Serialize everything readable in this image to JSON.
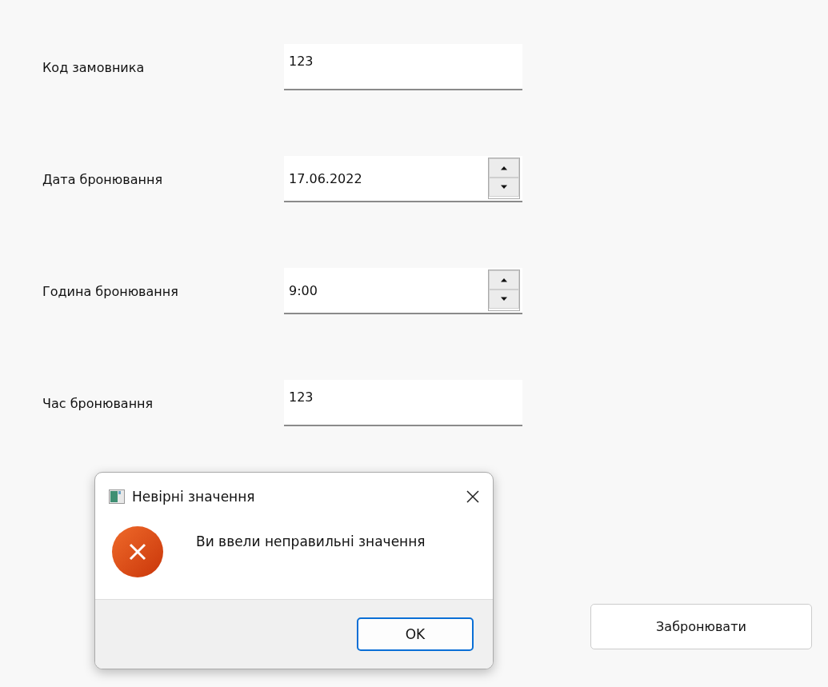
{
  "form": {
    "rows": [
      {
        "label": "Код замовника",
        "kind": "text",
        "value": "123"
      },
      {
        "label": "Дата бронювання",
        "kind": "spin",
        "value": "17.06.2022"
      },
      {
        "label": "Година бронювання",
        "kind": "spin",
        "value": "9:00"
      },
      {
        "label": "Час бронювання",
        "kind": "text",
        "value": "123"
      }
    ],
    "submit": "Забронювати"
  },
  "dialog": {
    "title": "Невірні значення",
    "message": "Ви ввели неправильні значення",
    "buttons": [
      "OK"
    ]
  }
}
